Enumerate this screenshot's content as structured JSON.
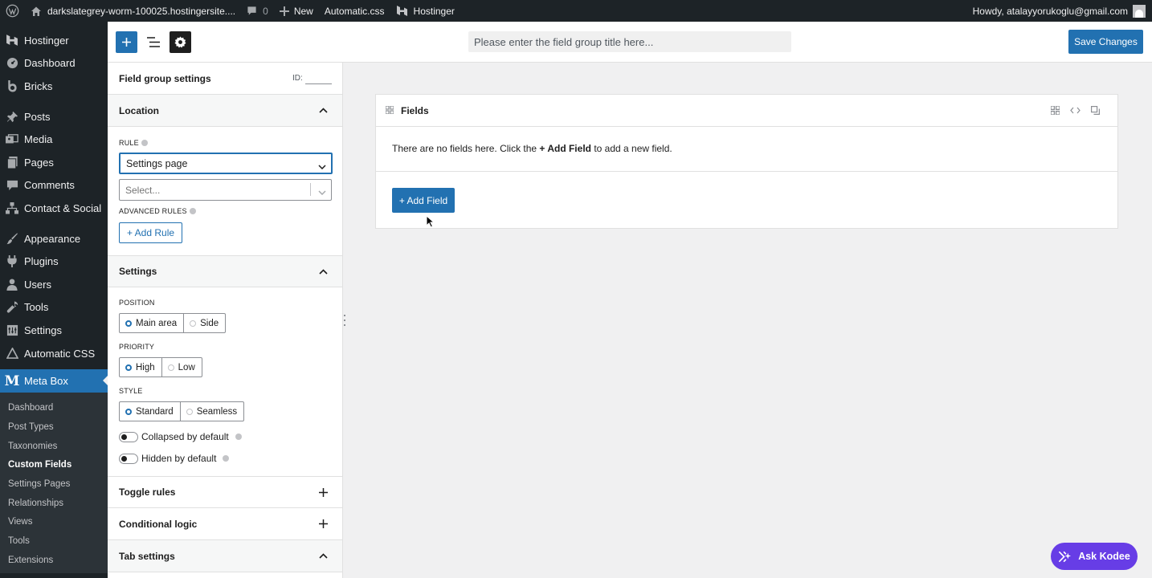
{
  "admin_bar": {
    "site_name": "darkslategrey-worm-100025.hostingersite....",
    "comments_count": "0",
    "new_label": "New",
    "automatic_css": "Automatic.css",
    "hostinger": "Hostinger",
    "howdy": "Howdy, atalayyorukoglu@gmail.com"
  },
  "admin_menu": {
    "items": [
      {
        "label": "Hostinger",
        "icon": "hostinger-icon"
      },
      {
        "label": "Dashboard",
        "icon": "dashboard-icon"
      },
      {
        "label": "Bricks",
        "icon": "bricks-icon"
      },
      {
        "label": "Posts",
        "icon": "pin-icon"
      },
      {
        "label": "Media",
        "icon": "media-icon"
      },
      {
        "label": "Pages",
        "icon": "page-icon"
      },
      {
        "label": "Comments",
        "icon": "comment-icon"
      },
      {
        "label": "Contact & Social",
        "icon": "network-icon"
      },
      {
        "label": "Appearance",
        "icon": "brush-icon"
      },
      {
        "label": "Plugins",
        "icon": "plug-icon"
      },
      {
        "label": "Users",
        "icon": "user-icon"
      },
      {
        "label": "Tools",
        "icon": "wrench-icon"
      },
      {
        "label": "Settings",
        "icon": "settings-icon"
      },
      {
        "label": "Automatic CSS",
        "icon": "triangle-icon"
      },
      {
        "label": "Meta Box",
        "icon": "metabox-icon"
      }
    ],
    "submenu": [
      "Dashboard",
      "Post Types",
      "Taxonomies",
      "Custom Fields",
      "Settings Pages",
      "Relationships",
      "Views",
      "Tools",
      "Extensions"
    ],
    "active_submenu": "Custom Fields"
  },
  "header": {
    "title_placeholder": "Please enter the field group title here...",
    "save_label": "Save Changes"
  },
  "sidebar": {
    "group_settings_title": "Field group settings",
    "id_label": "ID:",
    "location": {
      "title": "Location",
      "rule_label": "RULE",
      "rule_value": "Settings page",
      "second_select_placeholder": "Select...",
      "advanced_rules_label": "ADVANCED RULES",
      "add_rule_label": "+ Add Rule"
    },
    "settings": {
      "title": "Settings",
      "position_label": "POSITION",
      "position_options": [
        "Main area",
        "Side"
      ],
      "position_selected": "Main area",
      "priority_label": "PRIORITY",
      "priority_options": [
        "High",
        "Low"
      ],
      "priority_selected": "High",
      "style_label": "STYLE",
      "style_options": [
        "Standard",
        "Seamless"
      ],
      "style_selected": "Standard",
      "collapsed_label": "Collapsed by default",
      "collapsed_on": false,
      "hidden_label": "Hidden by default",
      "hidden_on": false
    },
    "toggle_rules": "Toggle rules",
    "conditional_logic": "Conditional logic",
    "tab_settings": "Tab settings"
  },
  "fields": {
    "title": "Fields",
    "empty_prefix": "There are no fields here. Click the ",
    "empty_bold": "+ Add Field",
    "empty_suffix": " to add a new field.",
    "add_field_label": "+ Add Field"
  },
  "kodee": {
    "label": "Ask Kodee",
    "color": "#673de6"
  },
  "colors": {
    "accent": "#2271b1",
    "admin_dark": "#1d2327"
  }
}
